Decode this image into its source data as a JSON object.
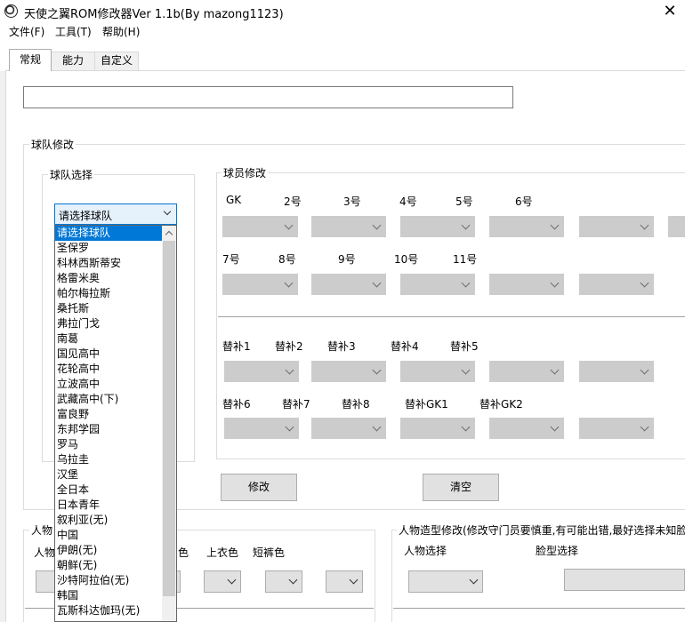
{
  "window": {
    "title": "天使之翼ROM修改器Ver 1.1b(By mazong1123)",
    "close_glyph": "✕"
  },
  "menu": [
    {
      "label": "文件(F)"
    },
    {
      "label": "工具(T)"
    },
    {
      "label": "帮助(H)"
    }
  ],
  "tabs": [
    {
      "label": "常规",
      "active": true
    },
    {
      "label": "能力"
    },
    {
      "label": "自定义"
    }
  ],
  "path_input": {
    "value": ""
  },
  "team_group": {
    "title": "球队修改",
    "team_select": {
      "title": "球队选择",
      "selected": "请选择球队",
      "options": [
        "请选择球队",
        "圣保罗",
        "科林西斯蒂安",
        "格雷米奥",
        "帕尔梅拉斯",
        "桑托斯",
        "弗拉门戈",
        "南葛",
        "国见高中",
        "花轮高中",
        "立波高中",
        "武藏高中(下)",
        "富良野",
        "东邦学园",
        "罗马",
        "乌拉圭",
        "汉堡",
        "全日本",
        "日本青年",
        "叙利亚(无)",
        "中国",
        "伊朗(无)",
        "朝鲜(无)",
        "沙特阿拉伯(无)",
        "韩国",
        "瓦斯科达伽玛(无)"
      ]
    },
    "players": {
      "title": "球员修改",
      "row1_labels": [
        "GK",
        "2号",
        "3号",
        "4号",
        "5号",
        "6号"
      ],
      "row2_labels": [
        "7号",
        "8号",
        "9号",
        "10号",
        "11号"
      ],
      "row3_labels": [
        "替补1",
        "替补2",
        "替补3",
        "替补4",
        "替补5"
      ],
      "row4_labels": [
        "替补6",
        "替补7",
        "替补8",
        "替补GK1",
        "替补GK2"
      ]
    },
    "modify_button": "修改",
    "clear_button": "清空"
  },
  "person_group": {
    "title": "人物",
    "labels": [
      "人物",
      "色",
      "上衣色",
      "短裤色"
    ]
  },
  "appearance_group": {
    "title": "人物造型修改(修改守门员要慎重,有可能出错,最好选择未知脸",
    "person_label": "人物选择",
    "face_label": "脸型选择"
  }
}
